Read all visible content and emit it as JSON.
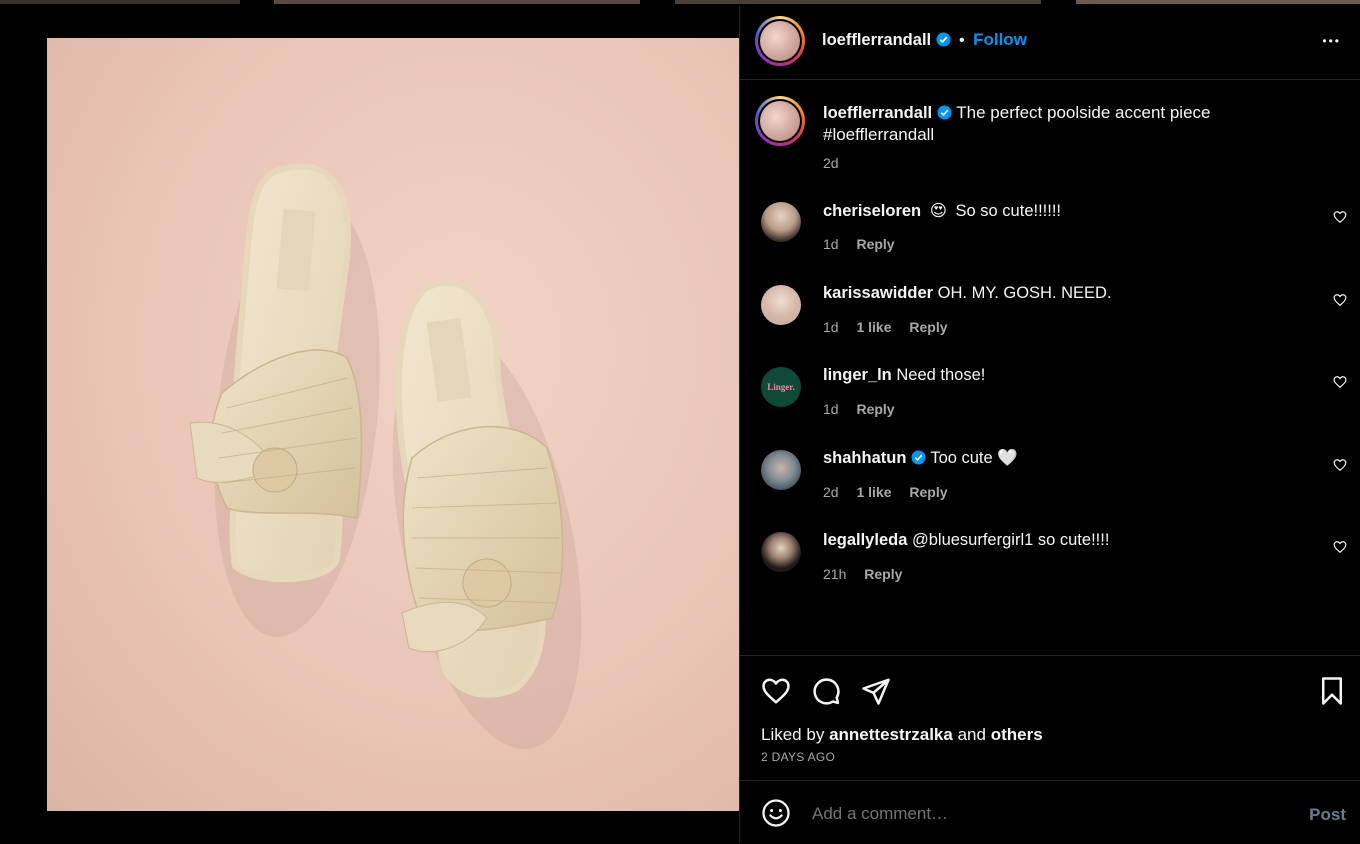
{
  "post": {
    "username": "loefflerrandall",
    "dot": "•",
    "follow_label": "Follow",
    "more_label": "•••",
    "caption_text": "The perfect poolside accent piece",
    "caption_tag": "#loefflerrandall",
    "caption_time": "2d"
  },
  "comments": [
    {
      "user": "cheriseloren",
      "emoji": "😍",
      "text": "So so cute!!!!!!",
      "time": "1d",
      "likes": "",
      "reply": "Reply",
      "verified": false
    },
    {
      "user": "karissawidder",
      "emoji": "",
      "text": "OH. MY. GOSH. NEED.",
      "time": "1d",
      "likes": "1 like",
      "reply": "Reply",
      "verified": false
    },
    {
      "user": "linger_ln",
      "emoji": "",
      "text": "Need those!",
      "time": "1d",
      "likes": "",
      "reply": "Reply",
      "verified": false,
      "avatar_text": "Linger."
    },
    {
      "user": "shahhatun",
      "emoji": "",
      "text": "Too cute 🤍",
      "time": "2d",
      "likes": "1 like",
      "reply": "Reply",
      "verified": true
    },
    {
      "user": "legallyleda",
      "emoji": "",
      "text": "@bluesurfergirl1 so cute!!!!",
      "time": "21h",
      "likes": "",
      "reply": "Reply",
      "verified": false
    }
  ],
  "likes": {
    "prefix": "Liked by",
    "user": "annettestrzalka",
    "middle": "and",
    "others": "others",
    "date": "2 DAYS AGO"
  },
  "add_comment": {
    "placeholder": "Add a comment…",
    "post_label": "Post"
  },
  "colors": {
    "accent": "#0095f6",
    "verified": "#0095f6",
    "linger_avatar_bg": "#0f4a38",
    "linger_avatar_text": "#f08aa8"
  },
  "icons": [
    "verified-badge-icon",
    "more-options-icon",
    "heart-icon",
    "comment-icon",
    "share-icon",
    "bookmark-icon",
    "emoji-icon"
  ]
}
